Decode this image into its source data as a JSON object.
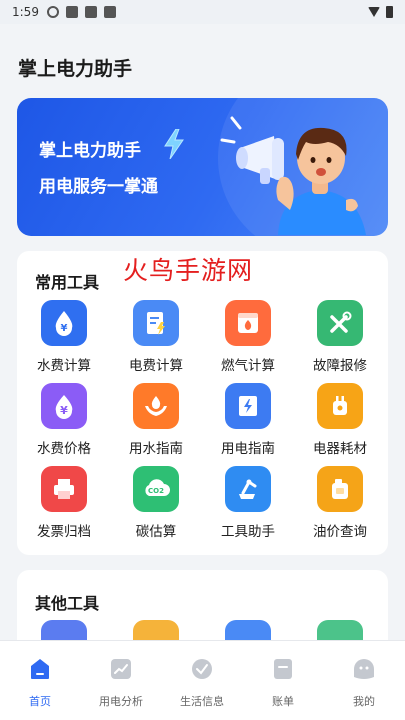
{
  "status_bar": {
    "time": "1:59"
  },
  "page_title": "掌上电力助手",
  "banner": {
    "line1": "掌上电力助手",
    "line2": "用电服务一掌通"
  },
  "watermark": "火鸟手游网",
  "tools_section": {
    "title": "常用工具",
    "items": [
      {
        "label": "水费计算",
        "icon": "water-drop-yen-icon",
        "color": "#2f6ff0"
      },
      {
        "label": "电费计算",
        "icon": "electric-bill-icon",
        "color": "#4a8af5"
      },
      {
        "label": "燃气计算",
        "icon": "gas-stove-icon",
        "color": "#ff6b3d"
      },
      {
        "label": "故障报修",
        "icon": "repair-tools-icon",
        "color": "#36b873"
      },
      {
        "label": "水费价格",
        "icon": "yen-drop-icon",
        "color": "#8b5cf6"
      },
      {
        "label": "用水指南",
        "icon": "hands-drop-icon",
        "color": "#ff7a29"
      },
      {
        "label": "用电指南",
        "icon": "electric-guide-icon",
        "color": "#3d7bf2"
      },
      {
        "label": "电器耗材",
        "icon": "plug-icon",
        "color": "#f7a416"
      },
      {
        "label": "发票归档",
        "icon": "printer-icon",
        "color": "#f04848"
      },
      {
        "label": "碳估算",
        "icon": "co2-cloud-icon",
        "color": "#2ebf74"
      },
      {
        "label": "工具助手",
        "icon": "mixer-icon",
        "color": "#2f8cf2"
      },
      {
        "label": "油价查询",
        "icon": "oil-can-icon",
        "color": "#f5a418"
      }
    ]
  },
  "other_section": {
    "title": "其他工具",
    "peek_colors": [
      "#5b7cf0",
      "#f5b33a",
      "#4a8af5",
      "#4cc38a"
    ]
  },
  "bottom_nav": [
    {
      "label": "首页",
      "icon": "home-icon",
      "active": true
    },
    {
      "label": "用电分析",
      "icon": "chart-trend-icon",
      "active": false
    },
    {
      "label": "生活信息",
      "icon": "check-bubble-icon",
      "active": false
    },
    {
      "label": "账单",
      "icon": "bill-icon",
      "active": false
    },
    {
      "label": "我的",
      "icon": "profile-icon",
      "active": false
    }
  ],
  "colors": {
    "accent": "#2f6af2",
    "background": "#f2f4f7"
  }
}
